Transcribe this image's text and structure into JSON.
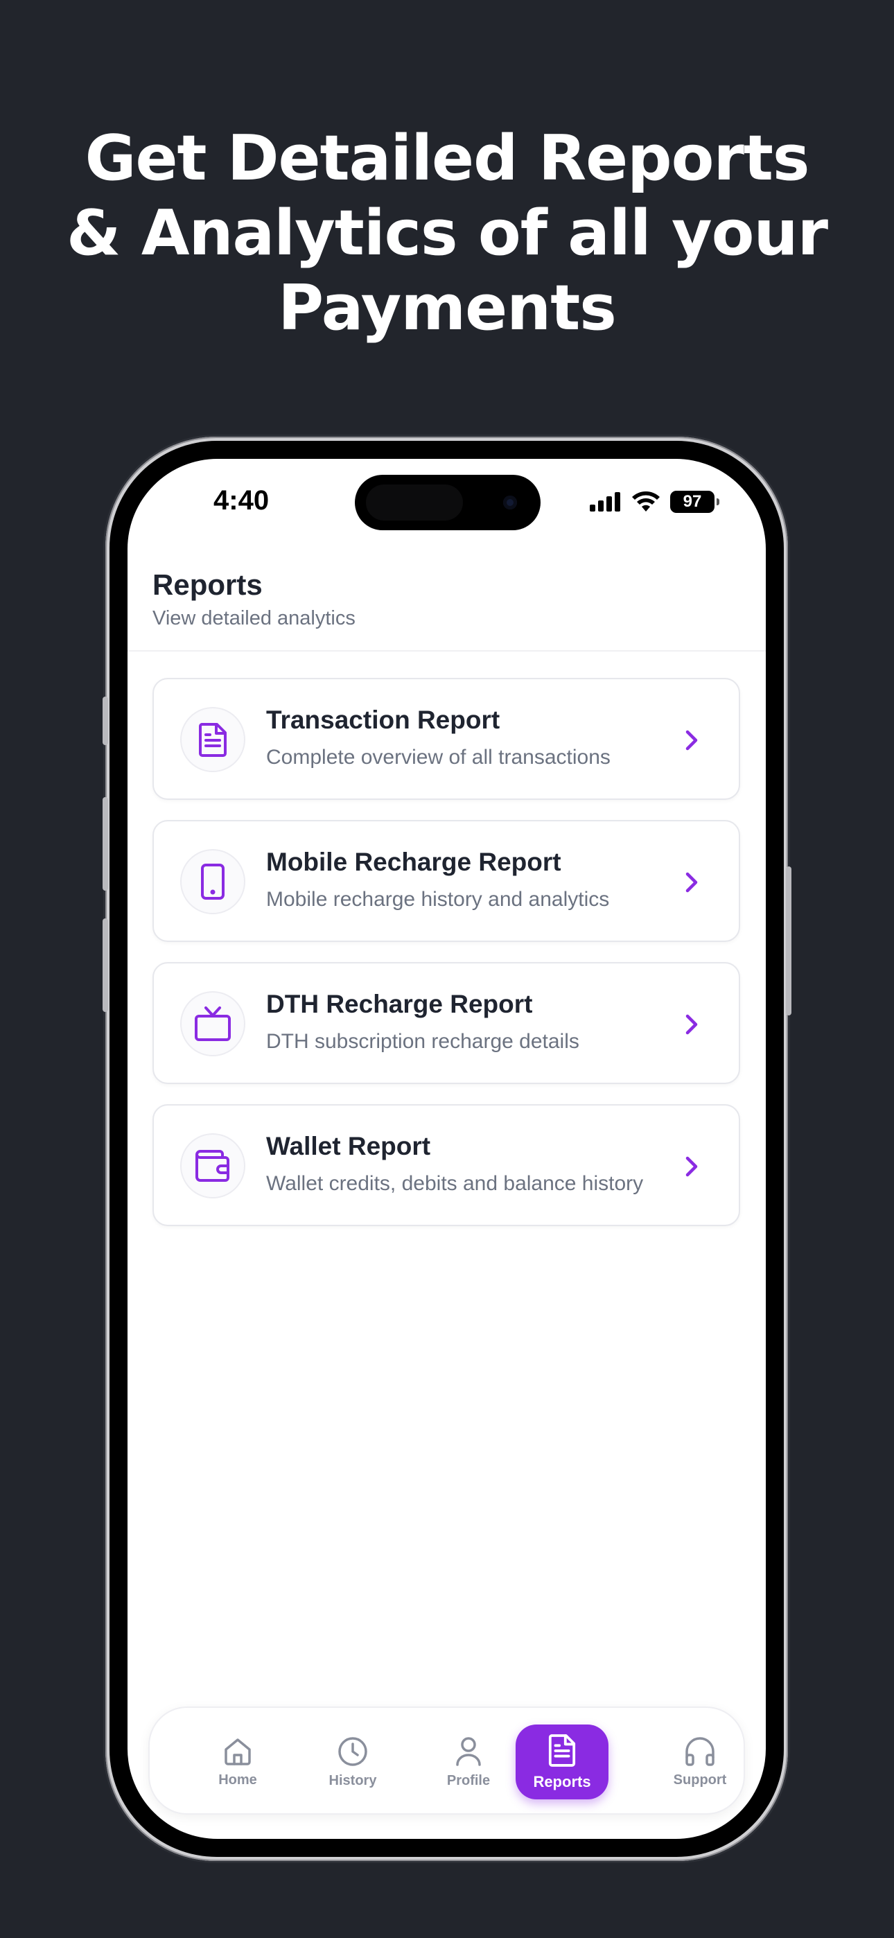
{
  "headline": "Get Detailed Reports & Analytics of all your Payments",
  "status_bar": {
    "time": "4:40",
    "battery": "97"
  },
  "header": {
    "title": "Reports",
    "subtitle": "View detailed analytics"
  },
  "colors": {
    "accent": "#8a2be2",
    "background": "#22252c",
    "text_primary": "#1f2430",
    "text_secondary": "#6b7280"
  },
  "reports": [
    {
      "title": "Transaction Report",
      "description": "Complete overview of all transactions",
      "icon": "document-icon"
    },
    {
      "title": "Mobile Recharge Report",
      "description": "Mobile recharge history and analytics",
      "icon": "smartphone-icon"
    },
    {
      "title": "DTH Recharge Report",
      "description": "DTH subscription recharge details",
      "icon": "tv-icon"
    },
    {
      "title": "Wallet Report",
      "description": "Wallet credits, debits and balance history",
      "icon": "wallet-icon"
    }
  ],
  "nav": [
    {
      "label": "Home",
      "icon": "home-icon",
      "active": false
    },
    {
      "label": "History",
      "icon": "clock-icon",
      "active": false
    },
    {
      "label": "Profile",
      "icon": "user-icon",
      "active": false
    },
    {
      "label": "Reports",
      "icon": "document-icon",
      "active": true
    },
    {
      "label": "Support",
      "icon": "headphones-icon",
      "active": false
    }
  ]
}
